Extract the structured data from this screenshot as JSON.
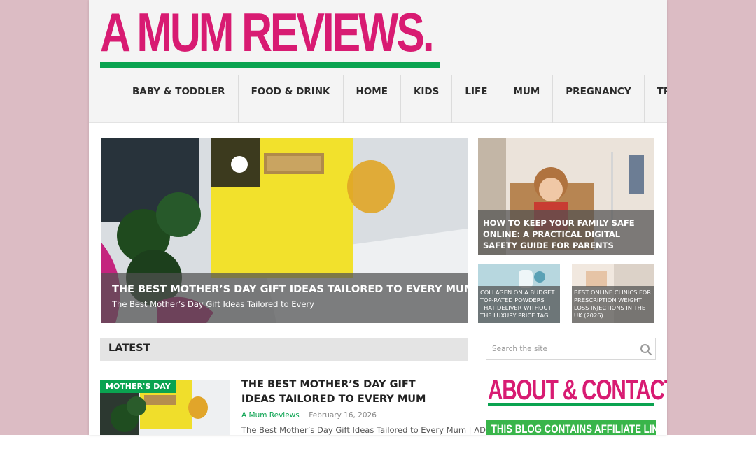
{
  "site": {
    "logo": "A MUM REVIEWS.",
    "colors": {
      "brand_pink": "#d81b72",
      "brand_green": "#0aa350",
      "page_bg": "#dcbcc4"
    }
  },
  "nav": {
    "items": [
      {
        "label": "BABY & TODDLER"
      },
      {
        "label": "FOOD & DRINK"
      },
      {
        "label": "HOME"
      },
      {
        "label": "KIDS"
      },
      {
        "label": "LIFE"
      },
      {
        "label": "MUM"
      },
      {
        "label": "PREGNANCY"
      },
      {
        "label": "TRAVEL"
      }
    ]
  },
  "featured": {
    "main": {
      "title": "THE BEST MOTHER’S DAY GIFT IDEAS TAILORED TO EVERY MUM",
      "subtitle": "The Best Mother’s Day Gift Ideas Tailored to Every"
    },
    "side": {
      "title": "HOW TO KEEP YOUR FAMILY SAFE ONLINE: A PRACTICAL DIGITAL SAFETY GUIDE FOR PARENTS"
    },
    "small": [
      {
        "title": "COLLAGEN ON A BUDGET: TOP-RATED POWDERS THAT DELIVER WITHOUT THE LUXURY PRICE TAG"
      },
      {
        "title": "BEST ONLINE CLINICS FOR PRESCRIPTION WEIGHT LOSS INJECTIONS IN THE UK (2026)"
      }
    ]
  },
  "latest": {
    "heading": "LATEST",
    "posts": [
      {
        "tag": "MOTHER'S DAY",
        "title": "THE BEST MOTHER’S DAY GIFT IDEAS TAILORED TO EVERY MUM",
        "author": "A Mum Reviews",
        "separator": "|",
        "date": "February 16, 2026",
        "excerpt": "The Best Mother’s Day Gift Ideas Tailored to Every Mum | AD"
      }
    ]
  },
  "sidebar": {
    "search": {
      "placeholder": "Search the site",
      "icon": "search-icon"
    },
    "about_title": "ABOUT & CONTACT.",
    "affiliate_banner": "THIS BLOG CONTAINS AFFILIATE LINKS."
  }
}
